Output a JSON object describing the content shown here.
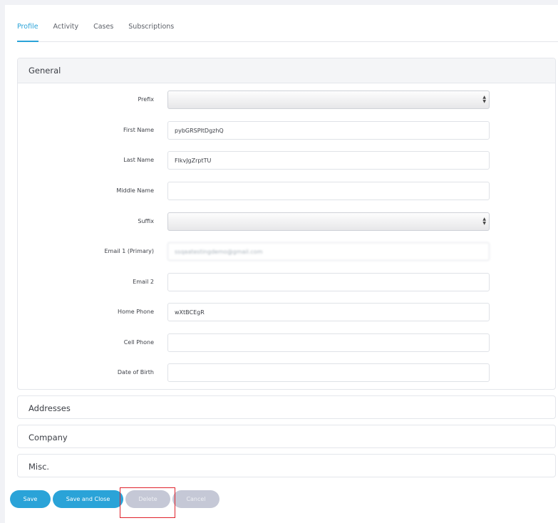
{
  "tabs": [
    {
      "label": "Profile",
      "active": true
    },
    {
      "label": "Activity",
      "active": false
    },
    {
      "label": "Cases",
      "active": false
    },
    {
      "label": "Subscriptions",
      "active": false
    }
  ],
  "sections": {
    "general": "General",
    "addresses": "Addresses",
    "company": "Company",
    "misc": "Misc."
  },
  "fields": {
    "prefix": {
      "label": "Prefix",
      "value": ""
    },
    "first_name": {
      "label": "First Name",
      "value": "pybGRSPltDgzhQ"
    },
    "last_name": {
      "label": "Last Name",
      "value": "FlkvJgZrptTU"
    },
    "middle_name": {
      "label": "Middle Name",
      "value": ""
    },
    "suffix": {
      "label": "Suffix",
      "value": ""
    },
    "email1": {
      "label": "Email 1 (Primary)",
      "value": "ssqaatestingdemo@gmail.com"
    },
    "email2": {
      "label": "Email 2",
      "value": ""
    },
    "home_phone": {
      "label": "Home Phone",
      "value": "wXtBCEgR"
    },
    "cell_phone": {
      "label": "Cell Phone",
      "value": ""
    },
    "dob": {
      "label": "Date of Birth",
      "value": ""
    }
  },
  "buttons": {
    "save": "Save",
    "save_close": "Save and Close",
    "delete": "Delete",
    "cancel": "Cancel"
  },
  "colors": {
    "accent": "#2aa3d8",
    "disabled": "#c5c8d6",
    "highlight": "#e0222b"
  }
}
